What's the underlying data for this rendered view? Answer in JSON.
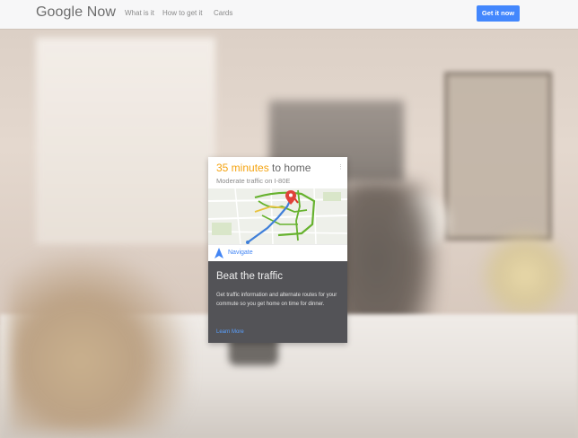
{
  "header": {
    "logo": "Google Now",
    "nav": [
      "What is it",
      "How to get it",
      "Cards"
    ],
    "cta_label": "Get it now"
  },
  "card": {
    "eta_time": "35 minutes",
    "eta_rest": " to home",
    "traffic": "Moderate traffic on I-80E",
    "navigate_label": "Navigate",
    "menu_icon": "more-vert-icon",
    "title": "Beat the traffic",
    "description": "Get traffic information and alternate routes for your commute so you get home on time for dinner.",
    "learn_more": "Learn More"
  },
  "colors": {
    "accent": "#4387fd",
    "eta": "#f4a310",
    "card_dark": "#535357",
    "link": "#4285f4"
  }
}
